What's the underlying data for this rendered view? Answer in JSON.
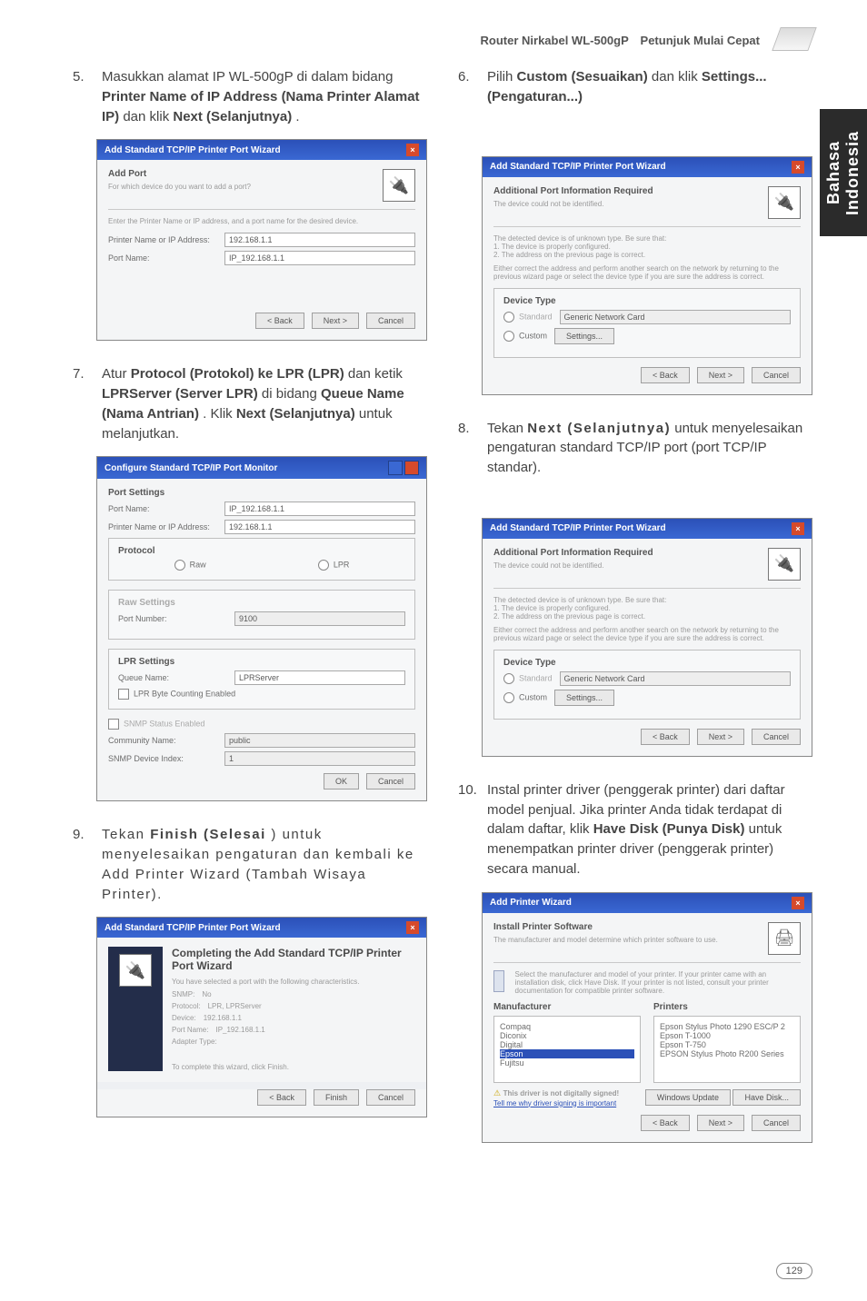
{
  "header": {
    "title": "Router Nirkabel WL-500gP　Petunjuk Mulai Cepat"
  },
  "sideTab": {
    "line1": "Bahasa",
    "line2": "Indonesia"
  },
  "steps": {
    "s5": {
      "num": "5.",
      "text_a": "Masukkan alamat IP WL-500gP di dalam bidang ",
      "bold_a": "Printer Name of IP Address (Nama Printer Alamat IP)",
      "text_b": " dan klik ",
      "bold_b": "Next (Selanjutnya)",
      "text_c": "."
    },
    "s6": {
      "num": "6.",
      "text_a": "Pilih ",
      "bold_a": "Custom (Sesuaikan)",
      "text_b": " dan klik ",
      "bold_b": "Settings... (Pengaturan...)"
    },
    "s7": {
      "num": "7.",
      "text_a": "Atur ",
      "bold_a": "Protocol (Protokol) ke LPR (LPR)",
      "text_b": " dan ketik ",
      "bold_b": "LPRServer (Server LPR)",
      "text_c": " di bidang ",
      "bold_c": "Queue Name (Nama Antrian)",
      "text_d": ". Klik ",
      "bold_d": "Next (Selanjutnya)",
      "text_e": " untuk melanjutkan."
    },
    "s8": {
      "num": "8.",
      "text_a": "Tekan ",
      "bold_a": "Next (Selanjutnya)",
      "text_b": " untuk menyelesaikan pengaturan standard TCP/IP port (port TCP/IP standar)."
    },
    "s9": {
      "num": "9.",
      "text_a": "Tekan ",
      "bold_a": "Finish (Selesai",
      "text_b": ") untuk menyelesaikan pengaturan dan kembali ke Add Printer Wizard (Tambah Wisaya Printer)."
    },
    "s10": {
      "num": "10.",
      "text_a": "Instal printer driver (penggerak printer) dari daftar model penjual. Jika printer Anda tidak terdapat di dalam daftar, klik ",
      "bold_a": "Have Disk (Punya Disk)",
      "text_b": " untuk menempatkan printer driver (penggerak printer) secara manual."
    }
  },
  "shot5": {
    "title": "Add Standard TCP/IP Printer Port Wizard",
    "head": "Add Port",
    "headSub": "For which device do you want to add a port?",
    "desc": "Enter the Printer Name or IP address, and a port name for the desired device.",
    "l1": "Printer Name or IP Address:",
    "v1": "192.168.1.1",
    "l2": "Port Name:",
    "v2": "IP_192.168.1.1",
    "btnBack": "< Back",
    "btnNext": "Next >",
    "btnCancel": "Cancel"
  },
  "shot6": {
    "title": "Add Standard TCP/IP Printer Port Wizard",
    "head": "Additional Port Information Required",
    "headSub": "The device could not be identified.",
    "desc1": "The detected device is of unknown type. Be sure that:",
    "li1": "1. The device is properly configured.",
    "li2": "2. The address on the previous page is correct.",
    "desc2": "Either correct the address and perform another search on the network by returning to the previous wizard page or select the device type if you are sure the address is correct.",
    "devType": "Device Type",
    "rStd": "Standard",
    "stdSel": "Generic Network Card",
    "rCustom": "Custom",
    "btnSettings": "Settings...",
    "btnBack": "< Back",
    "btnNext": "Next >",
    "btnCancel": "Cancel"
  },
  "shot7": {
    "title": "Configure Standard TCP/IP Port Monitor",
    "section": "Port Settings",
    "lPortName": "Port Name:",
    "vPortName": "IP_192.168.1.1",
    "lPrinter": "Printer Name or IP Address:",
    "vPrinter": "192.168.1.1",
    "proto": "Protocol",
    "rRaw": "Raw",
    "rLpr": "LPR",
    "rawHead": "Raw Settings",
    "lRawPort": "Port Number:",
    "vRawPort": "9100",
    "lprHead": "LPR Settings",
    "lQueue": "Queue Name:",
    "vQueue": "LPRServer",
    "cbLprByte": "LPR Byte Counting Enabled",
    "cbSnmp": "SNMP Status Enabled",
    "lComm": "Community Name:",
    "vComm": "public",
    "lIdx": "SNMP Device Index:",
    "vIdx": "1",
    "btnOk": "OK",
    "btnCancel": "Cancel"
  },
  "shot8": {
    "title": "Add Standard TCP/IP Printer Port Wizard",
    "head": "Additional Port Information Required",
    "headSub": "The device could not be identified.",
    "desc1": "The detected device is of unknown type. Be sure that:",
    "li1": "1. The device is properly configured.",
    "li2": "2. The address on the previous page is correct.",
    "desc2": "Either correct the address and perform another search on the network by returning to the previous wizard page or select the device type if you are sure the address is correct.",
    "devType": "Device Type",
    "rStd": "Standard",
    "stdSel": "Generic Network Card",
    "rCustom": "Custom",
    "btnSettings": "Settings...",
    "btnBack": "< Back",
    "btnNext": "Next >",
    "btnCancel": "Cancel"
  },
  "shot9": {
    "title": "Add Standard TCP/IP Printer Port Wizard",
    "head": "Completing the Add Standard TCP/IP Printer Port Wizard",
    "desc": "You have selected a port with the following characteristics.",
    "rows": {
      "r1l": "SNMP:",
      "r1v": "No",
      "r2l": "Protocol:",
      "r2v": "LPR, LPRServer",
      "r3l": "Device:",
      "r3v": "192.168.1.1",
      "r4l": "Port Name:",
      "r4v": "IP_192.168.1.1",
      "r5l": "Adapter Type:",
      "r5v": ""
    },
    "foot": "To complete this wizard, click Finish.",
    "btnBack": "< Back",
    "btnFinish": "Finish",
    "btnCancel": "Cancel"
  },
  "shot10": {
    "title": "Add Printer Wizard",
    "head": "Install Printer Software",
    "headSub": "The manufacturer and model determine which printer software to use.",
    "desc": "Select the manufacturer and model of your printer. If your printer came with an installation disk, click Have Disk. If your printer is not listed, consult your printer documentation for compatible printer software.",
    "colManu": "Manufacturer",
    "colPrinters": "Printers",
    "m1": "Compaq",
    "m2": "Diconix",
    "m3": "Digital",
    "m4": "Epson",
    "m5": "Fujitsu",
    "p1": "Epson Stylus Photo 1290 ESC/P 2",
    "p2": "Epson T-1000",
    "p3": "Epson T-750",
    "p4": "EPSON Stylus Photo R200 Series",
    "signed": "This driver is not digitally signed!",
    "tell": "Tell me why driver signing is important",
    "btnWU": "Windows Update",
    "btnHD": "Have Disk...",
    "btnBack": "< Back",
    "btnNext": "Next >",
    "btnCancel": "Cancel"
  },
  "pageNum": "129"
}
